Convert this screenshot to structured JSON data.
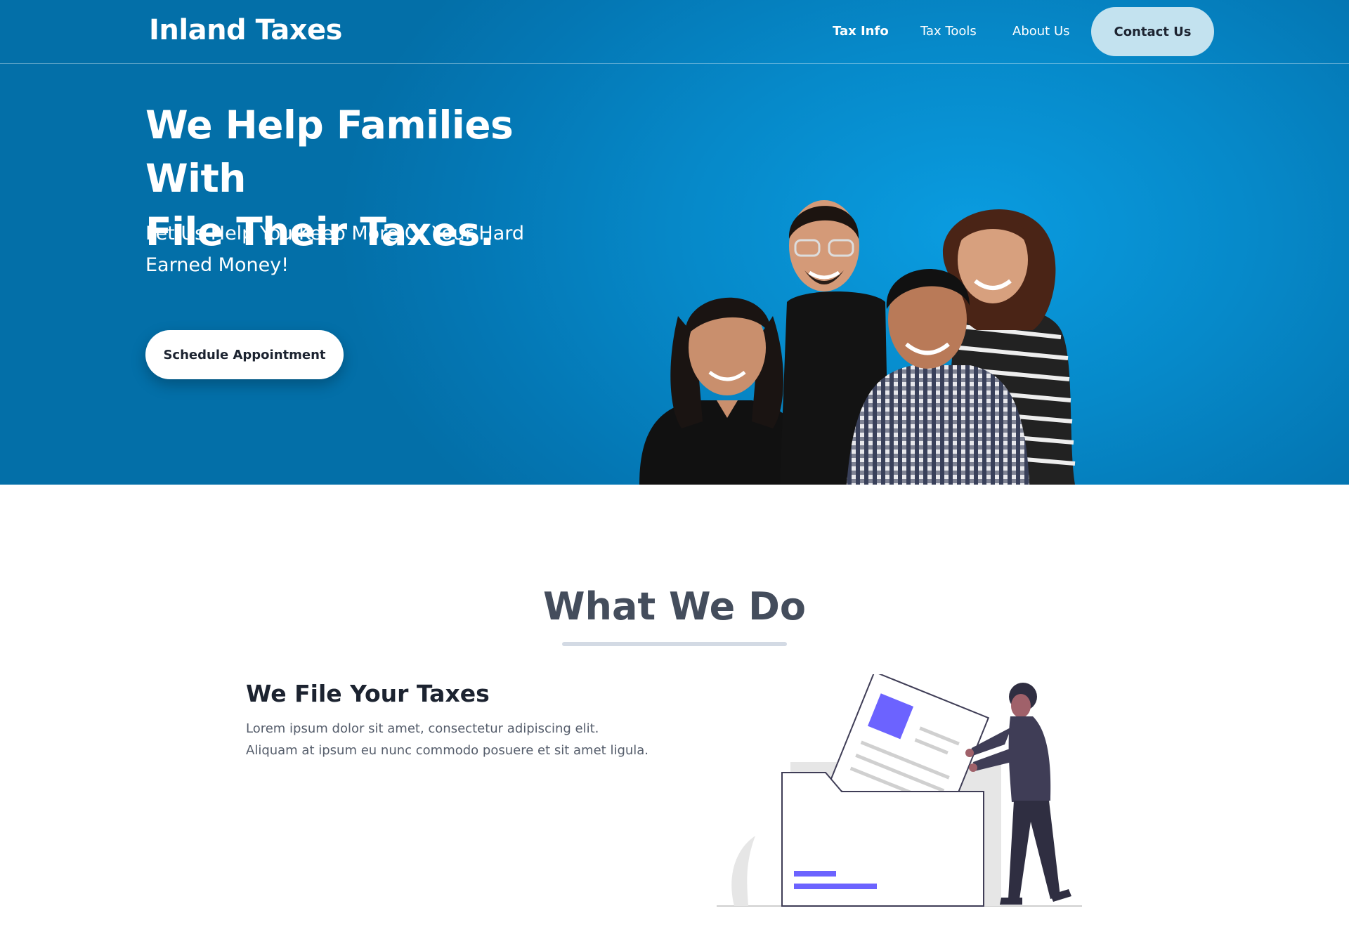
{
  "nav": {
    "brand": "Inland Taxes",
    "links": [
      {
        "label": "Tax Info",
        "active": true
      },
      {
        "label": "Tax Tools",
        "active": false
      },
      {
        "label": "About Us",
        "active": false
      }
    ],
    "contact_label": "Contact Us"
  },
  "hero": {
    "title_line1": "We Help Families With",
    "title_line2": "File Their Taxes.",
    "subtitle": "Let Us Help You Keep More Of Your Hard Earned Money!",
    "cta_label": "Schedule Appointment"
  },
  "what_we_do": {
    "heading": "What We Do",
    "feature": {
      "title": "We File Your Taxes",
      "text": "Lorem ipsum dolor sit amet, consectetur adipiscing elit. Aliquam at ipsum eu nunc commodo posuere et sit amet ligula."
    }
  },
  "colors": {
    "hero_blue": "#0689c9",
    "contact_button": "#c3e2ef",
    "accent_purple": "#6c63ff",
    "heading_gray": "#444d5c"
  }
}
